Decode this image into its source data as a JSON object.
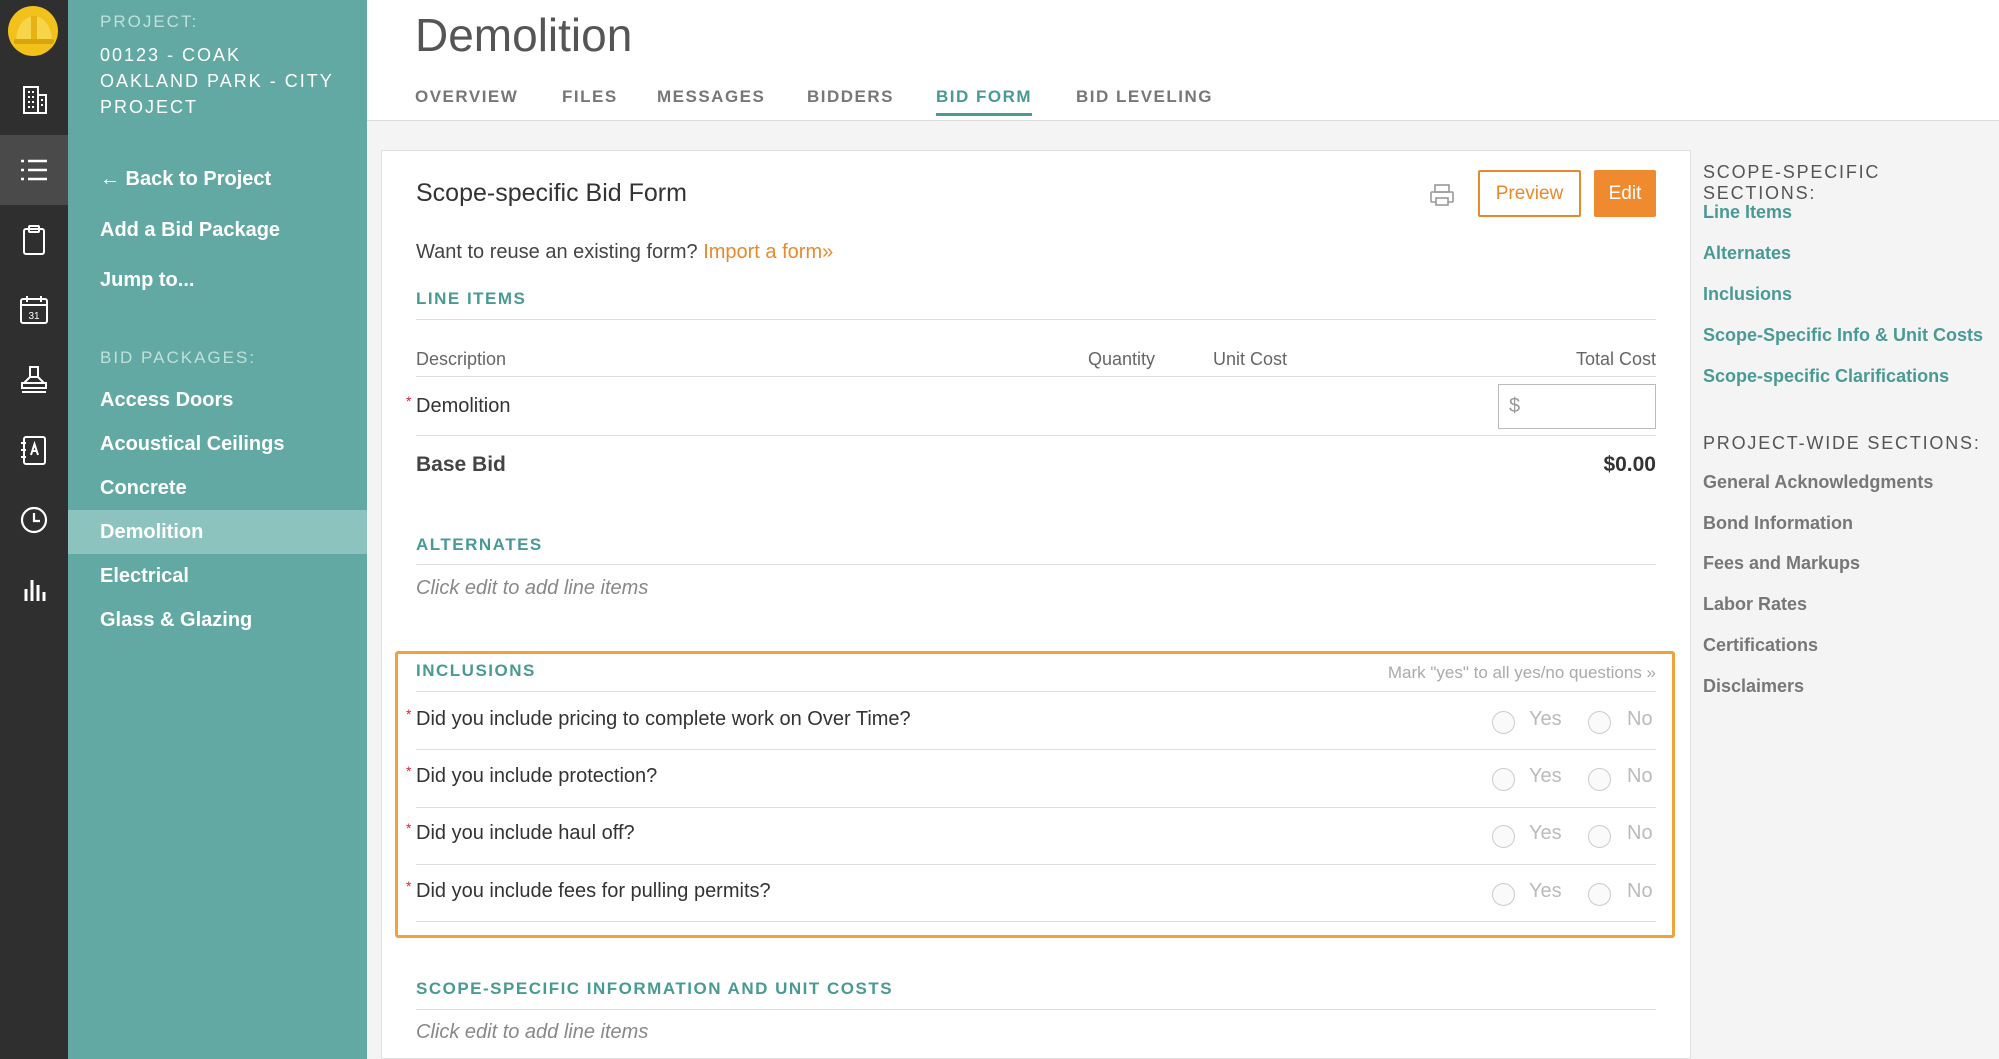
{
  "project": {
    "label": "PROJECT:",
    "name": "00123 - COAK OAKLAND PARK - CITY PROJECT"
  },
  "sidebar": {
    "back_link": "← Back to Project",
    "add_package": "Add a Bid Package",
    "jump_to": "Jump to...",
    "packages_heading": "BID PACKAGES:",
    "packages": [
      "Access Doors",
      "Acoustical Ceilings",
      "Concrete",
      "Demolition",
      "Electrical",
      "Glass & Glazing"
    ],
    "active_package": "Demolition"
  },
  "rail": {
    "icons": [
      "hardhat-logo-icon",
      "building-icon",
      "list-icon",
      "clipboard-icon",
      "calendar-icon",
      "stamp-icon",
      "contacts-book-icon",
      "clock-icon",
      "bar-chart-icon"
    ],
    "calendar_day": "31",
    "active": "list-icon"
  },
  "header": {
    "title": "Demolition",
    "tabs": [
      "OVERVIEW",
      "FILES",
      "MESSAGES",
      "BIDDERS",
      "BID FORM",
      "BID LEVELING"
    ],
    "active_tab": "BID FORM"
  },
  "form": {
    "title": "Scope-specific Bid Form",
    "preview_label": "Preview",
    "edit_label": "Edit",
    "reuse_text": "Want to reuse an existing form?",
    "import_link": "Import a form»",
    "line_items": {
      "heading": "LINE ITEMS",
      "columns": {
        "description": "Description",
        "quantity": "Quantity",
        "unit_cost": "Unit Cost",
        "total_cost": "Total Cost"
      },
      "rows": [
        {
          "description": "Demolition",
          "required_mark": "*",
          "total_placeholder": "$"
        }
      ],
      "base_bid_label": "Base Bid",
      "base_bid_value": "$0.00"
    },
    "alternates": {
      "heading": "ALTERNATES",
      "hint": "Click edit to add line items"
    },
    "inclusions": {
      "heading": "INCLUSIONS",
      "mark_all": "Mark \"yes\" to all yes/no questions »",
      "yes_label": "Yes",
      "no_label": "No",
      "required_mark": "*",
      "questions": [
        "Did you include pricing to complete work on Over Time?",
        "Did you include protection?",
        "Did you include haul off?",
        "Did you include fees for pulling permits?"
      ]
    },
    "scope_info": {
      "heading": "SCOPE-SPECIFIC INFORMATION AND UNIT COSTS",
      "hint": "Click edit to add line items"
    }
  },
  "rightnav": {
    "scope_heading": "SCOPE-SPECIFIC SECTIONS:",
    "scope_links": [
      "Line Items",
      "Alternates",
      "Inclusions",
      "Scope-Specific Info & Unit Costs",
      "Scope-specific Clarifications"
    ],
    "project_heading": "PROJECT-WIDE SECTIONS:",
    "project_links": [
      "General Acknowledgments",
      "Bond Information",
      "Fees and Markups",
      "Labor Rates",
      "Certifications",
      "Disclaimers"
    ]
  },
  "colors": {
    "teal": "#63a9a3",
    "teal_text": "#4a9a94",
    "orange": "#ef8a2f",
    "rail": "#2f2f2f"
  }
}
